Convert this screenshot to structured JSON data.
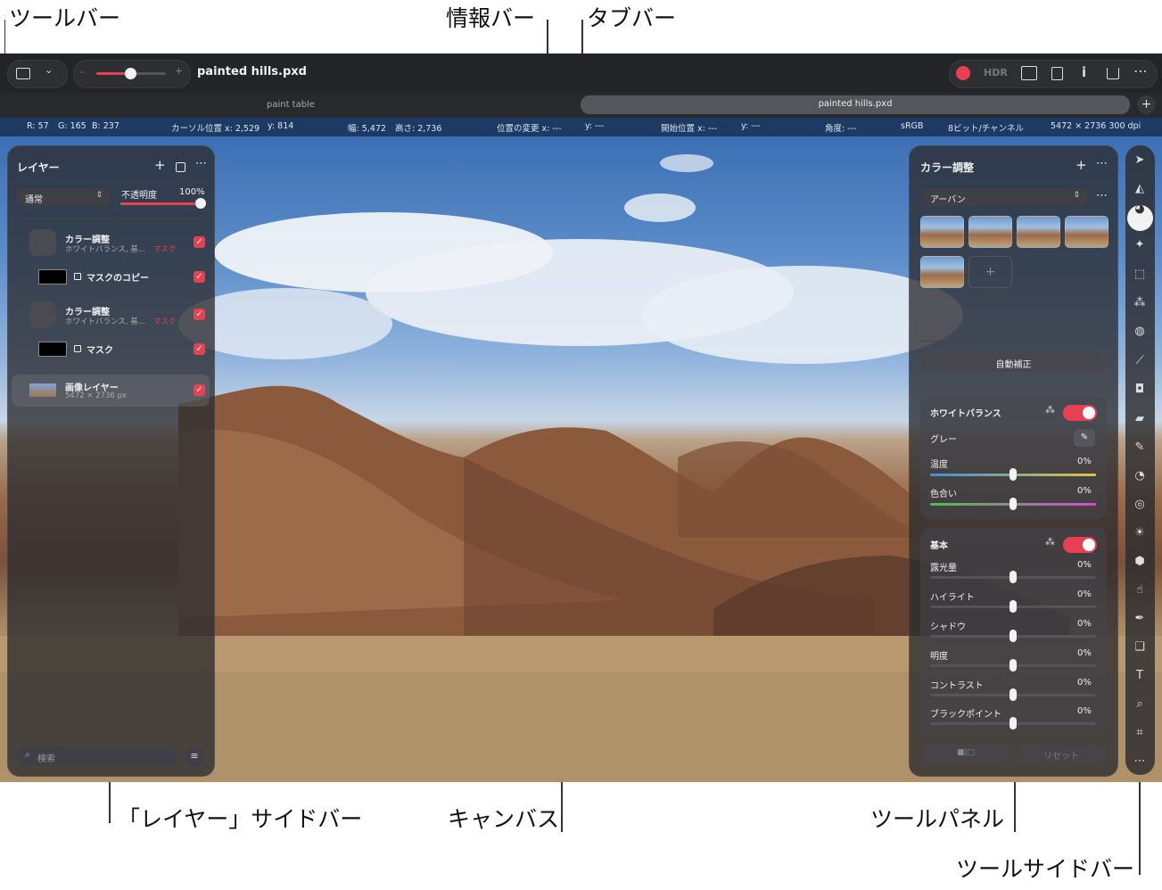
{
  "callouts": {
    "toolbar": "ツールバー",
    "infobar": "情報バー",
    "tabbar": "タブバー",
    "layers_sidebar": "「レイヤー」サイドバー",
    "canvas": "キャンバス",
    "tool_panel": "ツールパネル",
    "tool_sidebar": "ツールサイドバー"
  },
  "toolbar": {
    "doc_title": "painted hills.pxd",
    "zoom_minus": "-",
    "zoom_plus": "+",
    "hdr_label": "HDR",
    "info_label": "i",
    "more_label": "⋯"
  },
  "tabs": [
    {
      "label": "paint table",
      "active": false
    },
    {
      "label": "painted hills.pxd",
      "active": true
    }
  ],
  "tab_add": "+",
  "infobar": {
    "r": "R: 57",
    "g": "G: 165",
    "b": "B: 237",
    "cursor_x": "カーソル位置 x: 2,529",
    "cursor_y": "y: 814",
    "width": "幅: 5,472",
    "height": "高さ: 2,736",
    "move_x": "位置の変更 x: ---",
    "move_y": "y: ---",
    "start_x": "開始位置 x: ---",
    "start_y": "y: ---",
    "angle": "角度: ---",
    "colorspace": "sRGB",
    "bitdepth": "8ビット/チャンネル",
    "dimensions": "5472 × 2736 300 dpi"
  },
  "layers": {
    "title": "レイヤー",
    "add": "+",
    "more": "⋯",
    "blend_mode": "通常",
    "opacity_label": "不透明度",
    "opacity_value": "100%",
    "opacity_level": 1.0,
    "items": [
      {
        "name": "カラー調整",
        "sub": "ホワイトバランス, 基...",
        "mask_tag": "マスク"
      },
      {
        "name": "マスクのコピー"
      },
      {
        "name": "カラー調整",
        "sub": "ホワイトバランス, 基...",
        "mask_tag": "マスク"
      },
      {
        "name": "マスク"
      },
      {
        "name": "画像レイヤー",
        "sub": "5472 × 2736 px"
      }
    ],
    "search_placeholder": "検索"
  },
  "panel": {
    "title": "カラー調整",
    "add": "+",
    "more": "⋯",
    "preset": "アーバン",
    "thumb_add": "+",
    "auto_button": "自動補正",
    "white_balance": {
      "title": "ホワイトバランス",
      "gray_label": "グレー",
      "temp_label": "温度",
      "temp_value": "0%",
      "tint_label": "色合い",
      "tint_value": "0%"
    },
    "basic": {
      "title": "基本",
      "rows": [
        {
          "label": "露光量",
          "value": "0%"
        },
        {
          "label": "ハイライト",
          "value": "0%"
        },
        {
          "label": "シャドウ",
          "value": "0%"
        },
        {
          "label": "明度",
          "value": "0%"
        },
        {
          "label": "コントラスト",
          "value": "0%"
        },
        {
          "label": "ブラックポイント",
          "value": "0%"
        }
      ]
    },
    "compare_button": "■|□",
    "reset_button": "リセット"
  },
  "tools": [
    "arrow-icon",
    "paint-bucket-icon",
    "color-adjust-icon",
    "sparkle-icon",
    "marquee-icon",
    "magic-wand-icon",
    "quick-select-icon",
    "brush-icon",
    "fill-icon",
    "eraser-icon",
    "pencil-icon",
    "retouch-icon",
    "blur-icon",
    "light-icon",
    "cloud-icon",
    "smudge-icon",
    "pen-icon",
    "shapes-icon",
    "text-icon",
    "zoom-icon",
    "crop-icon",
    "more-icon"
  ],
  "more_tools": "⋯",
  "colors": {
    "accent": "#e8404f",
    "infobar": "#1c3a63",
    "toolbar": "#232427"
  }
}
